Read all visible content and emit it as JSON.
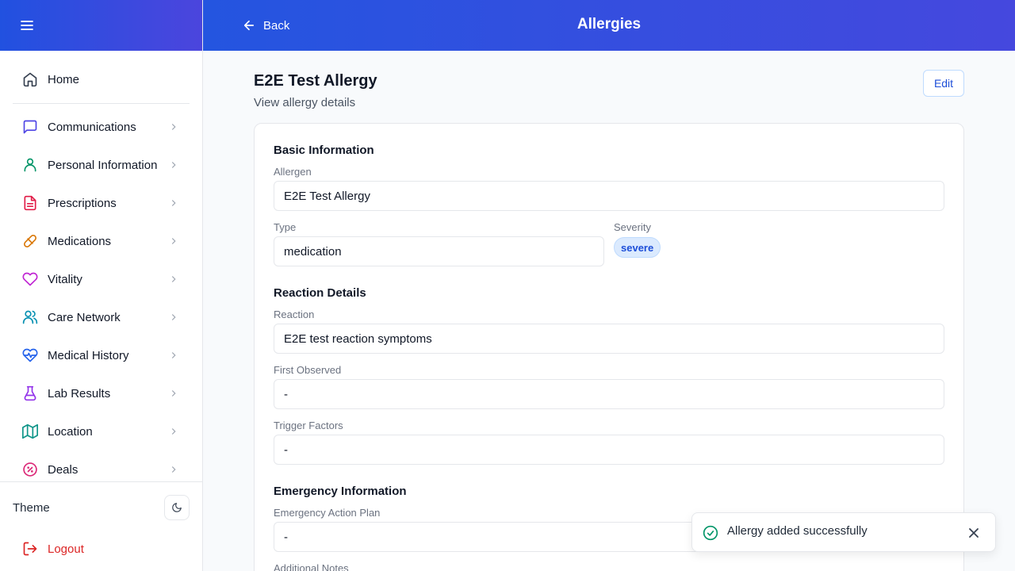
{
  "sidebar": {
    "items": [
      {
        "label": "Home",
        "icon": "home-icon",
        "color": "#374151"
      },
      {
        "label": "Communications",
        "icon": "message-square-icon",
        "color": "#4f46e5"
      },
      {
        "label": "Personal Information",
        "icon": "user-icon",
        "color": "#059669"
      },
      {
        "label": "Prescriptions",
        "icon": "file-text-icon",
        "color": "#e11d48"
      },
      {
        "label": "Medications",
        "icon": "pill-icon",
        "color": "#d97706"
      },
      {
        "label": "Vitality",
        "icon": "heart-icon",
        "color": "#c026d3"
      },
      {
        "label": "Care Network",
        "icon": "users-icon",
        "color": "#0891b2"
      },
      {
        "label": "Medical History",
        "icon": "heart-pulse-icon",
        "color": "#2563eb"
      },
      {
        "label": "Lab Results",
        "icon": "flask-icon",
        "color": "#9333ea"
      },
      {
        "label": "Location",
        "icon": "map-icon",
        "color": "#0d9488"
      },
      {
        "label": "Deals",
        "icon": "badge-percent-icon",
        "color": "#db2777"
      }
    ],
    "theme_label": "Theme",
    "logout_label": "Logout"
  },
  "topbar": {
    "back_label": "Back",
    "title": "Allergies"
  },
  "page": {
    "title": "E2E Test Allergy",
    "subtitle": "View allergy details",
    "edit_label": "Edit"
  },
  "basic": {
    "section_title": "Basic Information",
    "allergen_label": "Allergen",
    "allergen_value": "E2E Test Allergy",
    "type_label": "Type",
    "type_value": "medication",
    "severity_label": "Severity",
    "severity_value": "severe"
  },
  "reaction": {
    "section_title": "Reaction Details",
    "reaction_label": "Reaction",
    "reaction_value": "E2E test reaction symptoms",
    "first_observed_label": "First Observed",
    "first_observed_value": "-",
    "trigger_label": "Trigger Factors",
    "trigger_value": "-"
  },
  "emergency": {
    "section_title": "Emergency Information",
    "plan_label": "Emergency Action Plan",
    "plan_value": "-",
    "notes_label": "Additional Notes"
  },
  "toast": {
    "message": "Allergy added successfully"
  },
  "colors": {
    "accent": "#2455e0",
    "danger": "#dc2626",
    "success": "#059669"
  }
}
